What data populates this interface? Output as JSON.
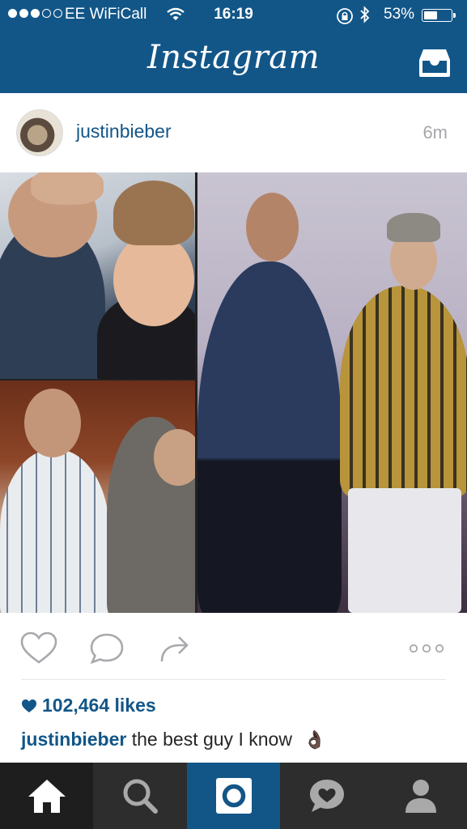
{
  "status_bar": {
    "carrier": "EE WiFiCall",
    "time": "16:19",
    "battery_percent": "53%",
    "battery_level": 0.53,
    "signal_bars_filled": 3,
    "signal_bars_total": 5
  },
  "header": {
    "app_title": "Instagram",
    "inbox_icon": "inbox-tray-icon"
  },
  "post": {
    "username": "justinbieber",
    "time_ago": "6m",
    "likes": "102,464 likes",
    "caption_username": "justinbieber",
    "caption_text": "the best guy I know",
    "caption_emoji": "👌🏿"
  },
  "actions": {
    "like_icon": "heart-icon",
    "comment_icon": "comment-bubble-icon",
    "share_icon": "share-arrow-icon",
    "more_icon": "more-dots-icon"
  },
  "tabs": [
    {
      "name": "home",
      "icon": "home-icon"
    },
    {
      "name": "search",
      "icon": "search-icon"
    },
    {
      "name": "camera",
      "icon": "camera-icon"
    },
    {
      "name": "activity",
      "icon": "heart-bubble-icon"
    },
    {
      "name": "profile",
      "icon": "profile-icon"
    }
  ],
  "colors": {
    "brand_blue": "#125688",
    "tabbar": "#2d2d2d",
    "meta_gray": "#a5a7aa"
  }
}
